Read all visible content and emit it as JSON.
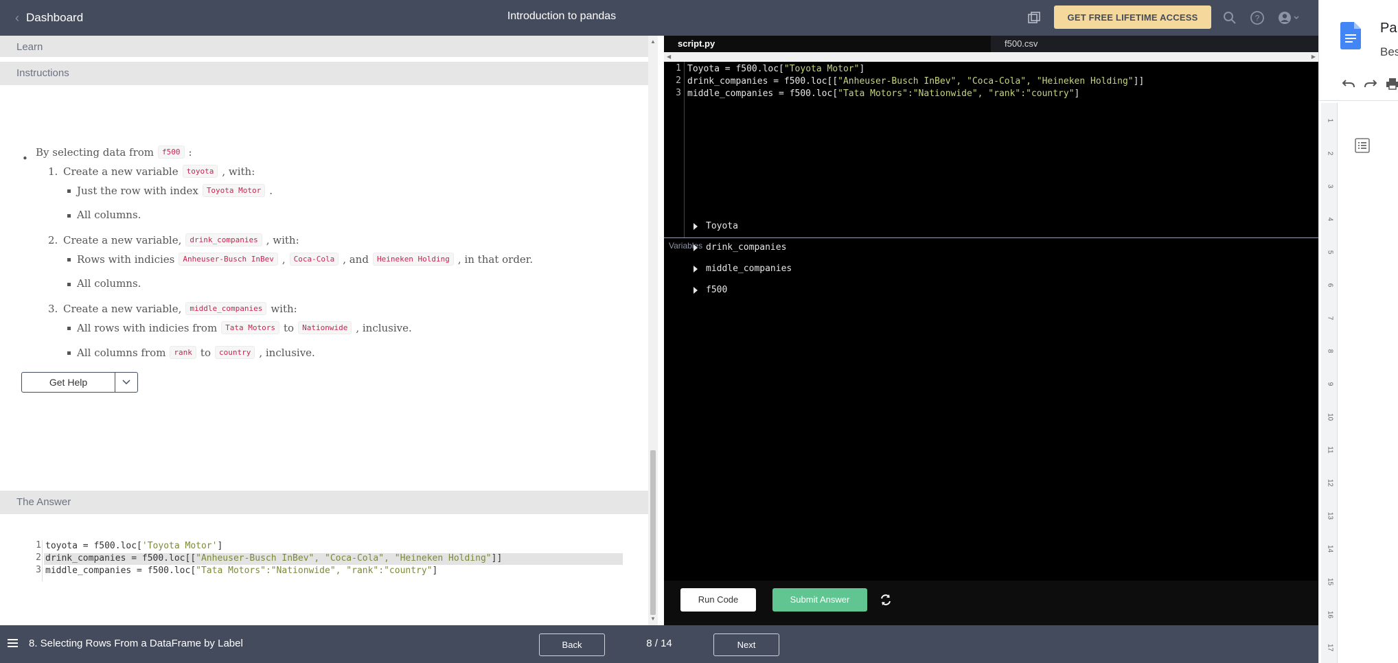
{
  "topbar": {
    "back_label": "Dashboard",
    "title": "Introduction to pandas",
    "cta_label": "GET FREE LIFETIME ACCESS"
  },
  "left": {
    "learn_label": "Learn",
    "instructions_label": "Instructions",
    "answer_label": "The Answer",
    "get_help_label": "Get Help",
    "instr": {
      "intro": "By selecting data from",
      "intro_code": "f500",
      "intro_tail": ":",
      "s1_num": "1.",
      "s1_text": "Create a new variable",
      "s1_code": "toyota",
      "s1_tail": ", with:",
      "s1_b1_text": "Just the row with index",
      "s1_b1_code": "Toyota Motor",
      "s1_b1_tail": ".",
      "s1_b2_text": "All columns.",
      "s2_num": "2.",
      "s2_text": "Create a new variable,",
      "s2_code": "drink_companies",
      "s2_tail": ", with:",
      "s2_b1_text": "Rows with indicies",
      "s2_b1_code1": "Anheuser-Busch InBev",
      "s2_b1_sep1": ",",
      "s2_b1_code2": "Coca-Cola",
      "s2_b1_sep2": ", and",
      "s2_b1_code3": "Heineken Holding",
      "s2_b1_tail": ", in that order.",
      "s2_b2_text": "All columns.",
      "s3_num": "3.",
      "s3_text": "Create a new variable,",
      "s3_code": "middle_companies",
      "s3_tail": "with:",
      "s3_b1_text": "All rows with indicies from",
      "s3_b1_code1": "Tata Motors",
      "s3_b1_sep": "to",
      "s3_b1_code2": "Nationwide",
      "s3_b1_tail": ", inclusive.",
      "s3_b2_text": "All columns from",
      "s3_b2_code1": "rank",
      "s3_b2_sep": "to",
      "s3_b2_code2": "country",
      "s3_b2_tail": ", inclusive."
    },
    "answer_lines": [
      {
        "num": "1",
        "pre": "toyota = f500.loc[",
        "str": "'Toyota Motor'",
        "post": "]"
      },
      {
        "num": "2",
        "pre": "drink_companies = f500.loc[[",
        "str": "\"Anheuser-Busch InBev\", \"Coca-Cola\", \"Heineken Holding\"",
        "post": "]]"
      },
      {
        "num": "3",
        "pre": "middle_companies = f500.loc[",
        "str": "\"Tata Motors\":\"Nationwide\", \"rank\":\"country\"",
        "post": "]"
      }
    ]
  },
  "editor": {
    "tab_active": "script.py",
    "tab_other": "f500.csv",
    "lines": [
      {
        "num": "1",
        "pre": "Toyota = f500.loc[",
        "str": "\"Toyota Motor\"",
        "post": "]"
      },
      {
        "num": "2",
        "pre": "drink_companies = f500.loc[[",
        "str": "\"Anheuser-Busch InBev\", \"Coca-Cola\", \"Heineken Holding\"",
        "post": "]]"
      },
      {
        "num": "3",
        "pre": "middle_companies = f500.loc[",
        "str": "\"Tata Motors\":\"Nationwide\", \"rank\":\"country\"",
        "post": "]"
      }
    ],
    "variables_label": "Variables",
    "variables": [
      "Toyota",
      "drink_companies",
      "middle_companies",
      "f500"
    ],
    "run_label": "Run Code",
    "submit_label": "Submit Answer"
  },
  "bottombar": {
    "lesson_title": "8. Selecting Rows From a DataFrame by Label",
    "back_label": "Back",
    "page_count": "8 / 14",
    "next_label": "Next"
  },
  "docs": {
    "title": "Pa",
    "subtitle": "Bes",
    "ruler_numbers": [
      "1",
      "2",
      "3",
      "4",
      "5",
      "6",
      "7",
      "8",
      "9",
      "10",
      "11",
      "12",
      "13",
      "14",
      "15",
      "16",
      "17"
    ]
  },
  "colors": {
    "topbar_bg": "#434b5c",
    "cta_bg": "#f5d99c",
    "submit_bg": "#60c591",
    "inline_code": "#c7254e"
  }
}
